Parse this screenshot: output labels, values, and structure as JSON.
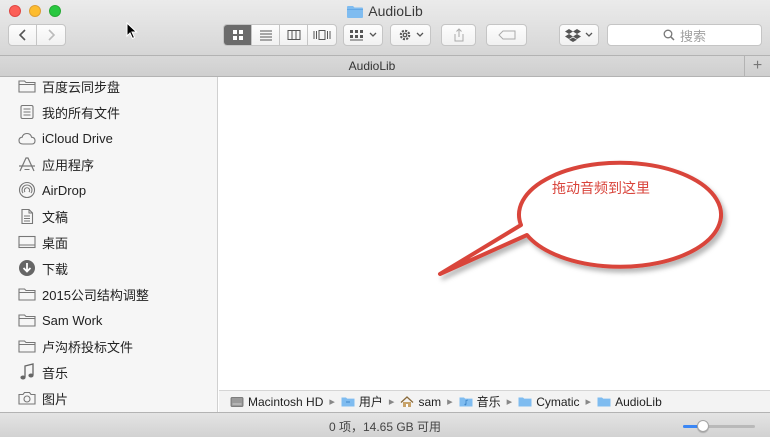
{
  "window": {
    "title": "AudioLib"
  },
  "toolbar": {
    "search_placeholder": "搜索"
  },
  "tab": {
    "label": "AudioLib",
    "add_label": "+"
  },
  "sidebar": {
    "items": [
      {
        "label": "百度云同步盘",
        "icon": "folder-icon"
      },
      {
        "label": "我的所有文件",
        "icon": "all-files-icon"
      },
      {
        "label": "iCloud Drive",
        "icon": "cloud-icon"
      },
      {
        "label": "应用程序",
        "icon": "applications-icon"
      },
      {
        "label": "AirDrop",
        "icon": "airdrop-icon"
      },
      {
        "label": "文稿",
        "icon": "documents-icon"
      },
      {
        "label": "桌面",
        "icon": "desktop-icon"
      },
      {
        "label": "下载",
        "icon": "download-icon"
      },
      {
        "label": "2015公司结构调整",
        "icon": "folder-icon"
      },
      {
        "label": "Sam Work",
        "icon": "folder-icon"
      },
      {
        "label": "卢沟桥投标文件",
        "icon": "folder-icon"
      },
      {
        "label": "音乐",
        "icon": "music-icon"
      },
      {
        "label": "图片",
        "icon": "camera-icon"
      }
    ]
  },
  "main": {
    "callout_text": "拖动音频到这里"
  },
  "pathbar": {
    "crumbs": [
      "Macintosh HD",
      "用户",
      "sam",
      "音乐",
      "Cymatic",
      "AudioLib"
    ],
    "separator": "▸"
  },
  "statusbar": {
    "text": "0 项，14.65 GB 可用",
    "zoom_level": 0.28
  },
  "colors": {
    "accent": "#3b87f5",
    "callout": "#d9443b",
    "folder": "#7fbcf0"
  }
}
